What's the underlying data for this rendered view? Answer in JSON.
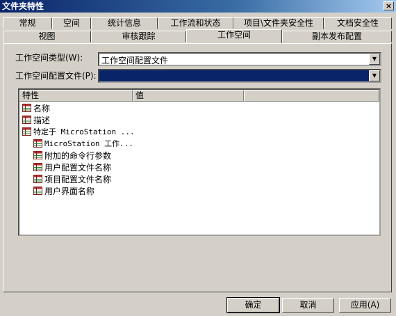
{
  "window": {
    "title": "文件夹特性",
    "close_glyph": "×"
  },
  "tabs_row1": [
    "常规",
    "空间",
    "统计信息",
    "工作流和状态",
    "项目\\文件夹安全性",
    "文档安全性"
  ],
  "tabs_row2": [
    "视图",
    "审核跟踪",
    "工作空间",
    "副本发布配置"
  ],
  "active_tab": "工作空间",
  "form": {
    "workspace_type_label": "工作空间类型(W):",
    "workspace_type_value": "工作空间配置文件",
    "workspace_profile_label": "工作空间配置文件(P):",
    "workspace_profile_value": ""
  },
  "listview": {
    "columns": [
      "特性",
      "值"
    ],
    "rows": [
      {
        "label": "名称",
        "indent": 0
      },
      {
        "label": "描述",
        "indent": 0
      },
      {
        "label": "特定于 MicroStation ...",
        "indent": 0
      },
      {
        "label": "MicroStation 工作...",
        "indent": 1
      },
      {
        "label": "附加的命令行参数",
        "indent": 1
      },
      {
        "label": "用户配置文件名称",
        "indent": 1
      },
      {
        "label": "项目配置文件名称",
        "indent": 1
      },
      {
        "label": "用户界面名称",
        "indent": 1
      }
    ]
  },
  "buttons": {
    "ok": "确定",
    "cancel": "取消",
    "apply": "应用(A)"
  },
  "icons": {
    "dropdown": "dropdown-arrow-icon",
    "row": "table-grid-icon"
  },
  "colors": {
    "title_bar": "#0a246a",
    "selection": "#0a246a",
    "face": "#d4d0c8"
  }
}
